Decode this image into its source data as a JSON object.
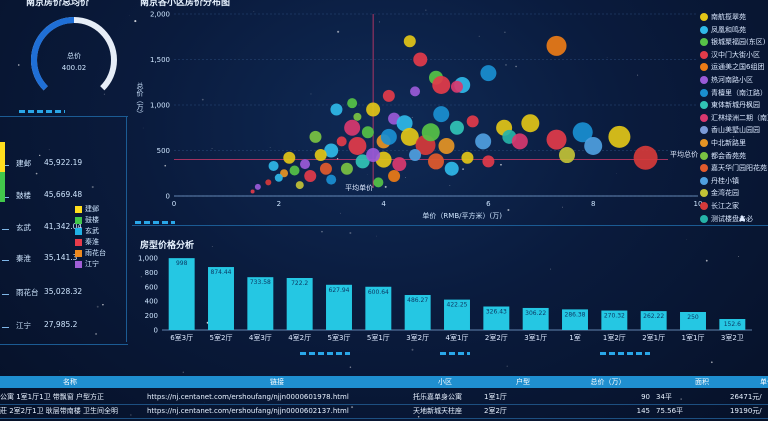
{
  "gauge": {
    "title": "南京房价总均价",
    "label": "总价",
    "value": 400.02,
    "max": 800,
    "color": "#1f6fd6"
  },
  "bubble": {
    "title": "南京各小区房价分布图",
    "y_label": "总价（万）",
    "x_label": "单价（RMB/平方米）(万)",
    "avg_unit_label": "平均单价",
    "avg_total_label": "平均总价"
  },
  "legend": {
    "items": [
      {
        "name": "南航揽翠苑",
        "color": "#e2c517"
      },
      {
        "name": "凤凰和鸣苑",
        "color": "#2fb9e8"
      },
      {
        "name": "银城聚福园(东区)",
        "color": "#56c247"
      },
      {
        "name": "汉中门大街小区",
        "color": "#e23b4a"
      },
      {
        "name": "运通美之国6组团",
        "color": "#eb7b16"
      },
      {
        "name": "热河南路小区",
        "color": "#9a5ad8"
      },
      {
        "name": "青檀里（南江路）",
        "color": "#1a8fd1"
      },
      {
        "name": "東体新城丹枫园",
        "color": "#31c4b6"
      },
      {
        "name": "汇林绿洲二期（南）",
        "color": "#d8386f"
      },
      {
        "name": "香山美墅山园园",
        "color": "#7b9bd8"
      },
      {
        "name": "中北新路里",
        "color": "#e59424"
      },
      {
        "name": "都会香苑苑",
        "color": "#7ac242"
      },
      {
        "name": "嘉天华门园阳花苑",
        "color": "#e15a2d"
      },
      {
        "name": "丹桂小镇",
        "color": "#4fa0e0"
      },
      {
        "name": "金湾花园",
        "color": "#c2c236"
      },
      {
        "name": "长江之家",
        "color": "#d63a3a"
      },
      {
        "name": "测试楼盘务必",
        "color": "#26b3a8"
      }
    ]
  },
  "left_table": {
    "rows": [
      {
        "name": "建邺",
        "value": "45,922.19",
        "color": "#ffde1e"
      },
      {
        "name": "鼓楼",
        "value": "45,669.48",
        "color": "#42c84b"
      },
      {
        "name": "玄武",
        "value": "41,342.04",
        "color": "#22b2e6"
      },
      {
        "name": "秦淮",
        "value": "35,141.3",
        "color": "#e83b4b"
      },
      {
        "name": "雨花台",
        "value": "35,028.32",
        "color": "#ee8a1f"
      },
      {
        "name": "江宁",
        "value": "27,985.2",
        "color": "#a05fd6"
      }
    ],
    "legend": [
      "建邺",
      "鼓楼",
      "玄武",
      "秦淮",
      "雨花台",
      "江宁"
    ]
  },
  "bar": {
    "title": "房型价格分析"
  },
  "table": {
    "headers": [
      "名称",
      "链接",
      "小区",
      "户型",
      "总价（万）",
      "面积",
      "单价"
    ],
    "rows": [
      [
        "公寓 1室1厅1卫 带飘窗 户型方正",
        "https://nj.centanet.com/ershoufang/njjn0000601978.html",
        "托乐嘉单身公寓",
        "1室1厅",
        "90",
        "34平",
        "26471元/"
      ],
      [
        "莊 2室2厅1卫 耿层带南楼 卫生间全明",
        "https://nj.centanet.com/ershoufang/njjn0000602137.html",
        "天地新城天柱座",
        "2室2厅",
        "145",
        "75.56平",
        "19190元/"
      ]
    ]
  },
  "chart_data": [
    {
      "type": "scatter",
      "title": "南京各小区房价分布图",
      "xlabel": "单价（RMB/平方米）(万)",
      "ylabel": "总价（万）",
      "xlim": [
        0,
        10
      ],
      "ylim": [
        0,
        2000
      ],
      "x_ticks": [
        0,
        2,
        4,
        6,
        8,
        10
      ],
      "y_ticks": [
        0,
        500,
        1000,
        1500,
        2000
      ],
      "mark_lines": {
        "avg_unit_price_x": 3.8,
        "avg_total_price_y": 400
      },
      "points": [
        {
          "x": 4.5,
          "y": 1700,
          "size": 6,
          "color": "#e2c517"
        },
        {
          "x": 5.5,
          "y": 1220,
          "size": 8,
          "color": "#2fb9e8"
        },
        {
          "x": 5.0,
          "y": 1300,
          "size": 7,
          "color": "#56c247"
        },
        {
          "x": 5.1,
          "y": 1220,
          "size": 9,
          "color": "#e23b4a"
        },
        {
          "x": 5.4,
          "y": 1200,
          "size": 6,
          "color": "#d8386f"
        },
        {
          "x": 7.3,
          "y": 1650,
          "size": 10,
          "color": "#eb7b16"
        },
        {
          "x": 6.0,
          "y": 1350,
          "size": 8,
          "color": "#1a8fd1"
        },
        {
          "x": 4.7,
          "y": 1500,
          "size": 7,
          "color": "#e23b4a"
        },
        {
          "x": 3.4,
          "y": 1020,
          "size": 5,
          "color": "#56c247"
        },
        {
          "x": 3.5,
          "y": 870,
          "size": 4,
          "color": "#7ac242"
        },
        {
          "x": 4.2,
          "y": 850,
          "size": 6,
          "color": "#9a5ad8"
        },
        {
          "x": 4.4,
          "y": 800,
          "size": 8,
          "color": "#2fb9e8"
        },
        {
          "x": 4.5,
          "y": 650,
          "size": 9,
          "color": "#e2c517"
        },
        {
          "x": 4.0,
          "y": 600,
          "size": 7,
          "color": "#e59424"
        },
        {
          "x": 4.8,
          "y": 560,
          "size": 10,
          "color": "#d63a3a"
        },
        {
          "x": 5.1,
          "y": 900,
          "size": 8,
          "color": "#1a8fd1"
        },
        {
          "x": 5.4,
          "y": 750,
          "size": 7,
          "color": "#31c4b6"
        },
        {
          "x": 5.7,
          "y": 820,
          "size": 6,
          "color": "#e23b4a"
        },
        {
          "x": 5.9,
          "y": 600,
          "size": 8,
          "color": "#4fa0e0"
        },
        {
          "x": 6.3,
          "y": 750,
          "size": 8,
          "color": "#e2c517"
        },
        {
          "x": 6.4,
          "y": 650,
          "size": 7,
          "color": "#26b3a8"
        },
        {
          "x": 6.8,
          "y": 800,
          "size": 9,
          "color": "#e2c517"
        },
        {
          "x": 6.6,
          "y": 600,
          "size": 8,
          "color": "#d8386f"
        },
        {
          "x": 7.3,
          "y": 620,
          "size": 10,
          "color": "#e23b4a"
        },
        {
          "x": 7.5,
          "y": 450,
          "size": 8,
          "color": "#c2c236"
        },
        {
          "x": 7.8,
          "y": 700,
          "size": 10,
          "color": "#1a8fd1"
        },
        {
          "x": 8.0,
          "y": 550,
          "size": 9,
          "color": "#4fa0e0"
        },
        {
          "x": 8.5,
          "y": 650,
          "size": 11,
          "color": "#e2c517"
        },
        {
          "x": 9.0,
          "y": 420,
          "size": 12,
          "color": "#d63a3a"
        },
        {
          "x": 3.7,
          "y": 700,
          "size": 6,
          "color": "#56c247"
        },
        {
          "x": 3.2,
          "y": 600,
          "size": 5,
          "color": "#e23b4a"
        },
        {
          "x": 3.0,
          "y": 500,
          "size": 7,
          "color": "#2fb9e8"
        },
        {
          "x": 2.8,
          "y": 450,
          "size": 6,
          "color": "#e2c517"
        },
        {
          "x": 2.5,
          "y": 350,
          "size": 5,
          "color": "#9a5ad8"
        },
        {
          "x": 2.3,
          "y": 280,
          "size": 5,
          "color": "#56c247"
        },
        {
          "x": 2.1,
          "y": 250,
          "size": 4,
          "color": "#e59424"
        },
        {
          "x": 2.0,
          "y": 200,
          "size": 4,
          "color": "#2fb9e8"
        },
        {
          "x": 2.6,
          "y": 220,
          "size": 6,
          "color": "#e23b4a"
        },
        {
          "x": 3.3,
          "y": 300,
          "size": 6,
          "color": "#7ac242"
        },
        {
          "x": 3.6,
          "y": 380,
          "size": 7,
          "color": "#31c4b6"
        },
        {
          "x": 4.0,
          "y": 400,
          "size": 8,
          "color": "#e2c517"
        },
        {
          "x": 4.3,
          "y": 350,
          "size": 7,
          "color": "#d8386f"
        },
        {
          "x": 4.6,
          "y": 450,
          "size": 6,
          "color": "#4fa0e0"
        },
        {
          "x": 5.0,
          "y": 380,
          "size": 8,
          "color": "#e15a2d"
        },
        {
          "x": 5.3,
          "y": 300,
          "size": 7,
          "color": "#2fb9e8"
        },
        {
          "x": 5.6,
          "y": 420,
          "size": 6,
          "color": "#e2c517"
        },
        {
          "x": 6.0,
          "y": 380,
          "size": 6,
          "color": "#e23b4a"
        },
        {
          "x": 4.2,
          "y": 220,
          "size": 6,
          "color": "#eb7b16"
        },
        {
          "x": 3.9,
          "y": 150,
          "size": 5,
          "color": "#56c247"
        },
        {
          "x": 3.0,
          "y": 180,
          "size": 5,
          "color": "#1a8fd1"
        },
        {
          "x": 2.4,
          "y": 120,
          "size": 4,
          "color": "#c2c236"
        },
        {
          "x": 1.8,
          "y": 150,
          "size": 3,
          "color": "#d63a3a"
        },
        {
          "x": 1.6,
          "y": 100,
          "size": 3,
          "color": "#9a5ad8"
        },
        {
          "x": 1.5,
          "y": 50,
          "size": 2,
          "color": "#e23b4a"
        },
        {
          "x": 3.1,
          "y": 950,
          "size": 6,
          "color": "#2fb9e8"
        },
        {
          "x": 3.8,
          "y": 950,
          "size": 7,
          "color": "#e2c517"
        },
        {
          "x": 4.1,
          "y": 1100,
          "size": 6,
          "color": "#e23b4a"
        },
        {
          "x": 4.6,
          "y": 1150,
          "size": 5,
          "color": "#9a5ad8"
        },
        {
          "x": 3.4,
          "y": 750,
          "size": 8,
          "color": "#d8386f"
        },
        {
          "x": 2.7,
          "y": 650,
          "size": 6,
          "color": "#7ac242"
        },
        {
          "x": 2.2,
          "y": 420,
          "size": 6,
          "color": "#e2c517"
        },
        {
          "x": 1.9,
          "y": 330,
          "size": 5,
          "color": "#2fb9e8"
        },
        {
          "x": 3.5,
          "y": 550,
          "size": 9,
          "color": "#e23b4a"
        },
        {
          "x": 4.9,
          "y": 700,
          "size": 9,
          "color": "#56c247"
        },
        {
          "x": 5.2,
          "y": 550,
          "size": 8,
          "color": "#e59424"
        },
        {
          "x": 4.1,
          "y": 650,
          "size": 8,
          "color": "#1a8fd1"
        },
        {
          "x": 3.8,
          "y": 450,
          "size": 7,
          "color": "#9a5ad8"
        },
        {
          "x": 2.9,
          "y": 300,
          "size": 6,
          "color": "#e15a2d"
        }
      ]
    },
    {
      "type": "bar",
      "title": "房型价格分析",
      "categories": [
        "6室3厅",
        "5室2厅",
        "4室3厅",
        "4室2厅",
        "5室3厅",
        "5室1厅",
        "3室2厅",
        "4室1厅",
        "2室2厅",
        "3室1厅",
        "1室",
        "1室2厅",
        "2室1厅",
        "1室1厅",
        "3室2卫"
      ],
      "values": [
        998,
        874.44,
        733.58,
        722.2,
        627.94,
        600.64,
        486.27,
        422.25,
        326.43,
        306.22,
        286.38,
        270.32,
        262.22,
        250,
        152.6
      ],
      "labels": [
        "998",
        "874.44",
        "733.58",
        "722.2",
        "627.94",
        "600.64",
        "486.27",
        "422.25",
        "326.43",
        "306.22",
        "286.38",
        "270.32",
        "262.22",
        "250",
        "152.6"
      ],
      "ylim": [
        0,
        1000
      ],
      "y_ticks": [
        0,
        200,
        400,
        600,
        800,
        1000
      ],
      "color": "#25c7e3"
    }
  ]
}
